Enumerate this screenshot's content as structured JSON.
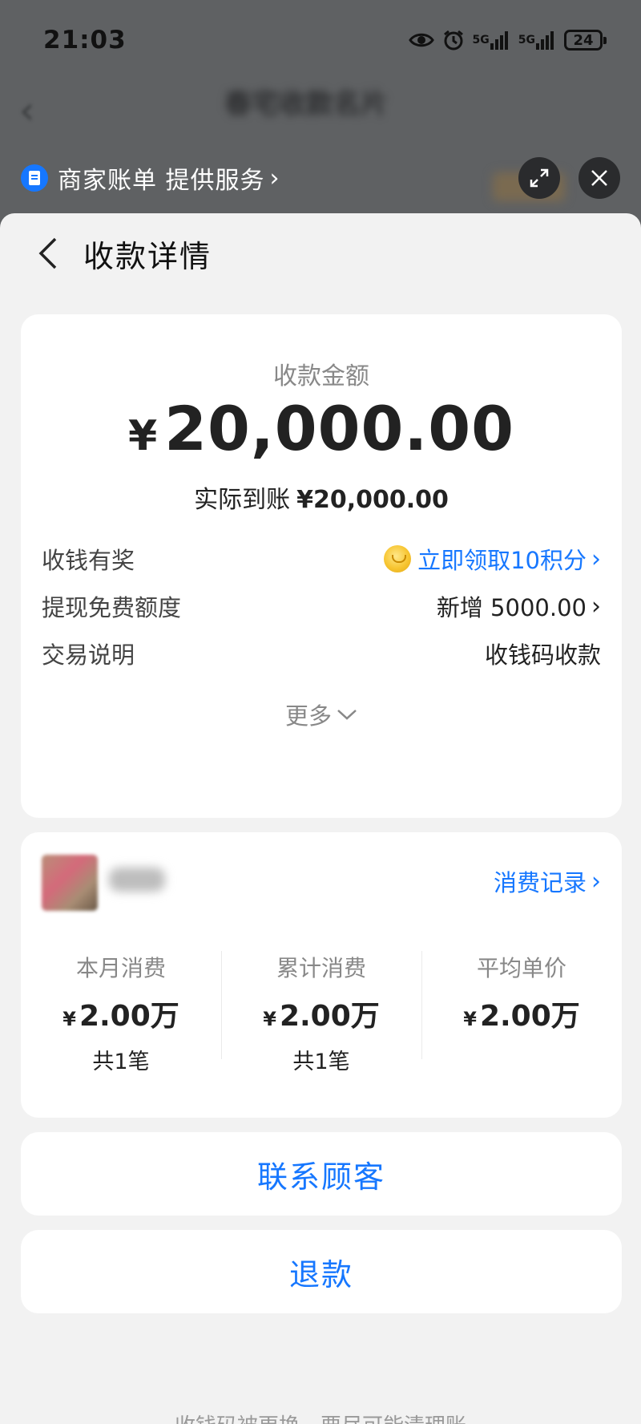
{
  "status_bar": {
    "time": "21:03",
    "signal_labels": [
      "5G",
      "5G"
    ],
    "battery": "24"
  },
  "background_page": {
    "back_glyph": "‹",
    "title": "春宅收款名片"
  },
  "mini_program": {
    "name": "商家账单 提供服务",
    "arrow": "›"
  },
  "header": {
    "title": "收款详情"
  },
  "amount_card": {
    "label": "收款金额",
    "currency": "¥",
    "amount": "20,000.00",
    "actual_label": "实际到账",
    "actual_value": "¥20,000.00",
    "rows": [
      {
        "label": "收钱有奖",
        "value": "立即领取10积分",
        "link": true
      },
      {
        "label": "提现免费额度",
        "value": "新增 5000.00",
        "link": false
      },
      {
        "label": "交易说明",
        "value": "收钱码收款",
        "link": false
      }
    ],
    "more_label": "更多"
  },
  "customer_card": {
    "records_link": "消费记录",
    "stats": [
      {
        "label": "本月消费",
        "currency": "¥",
        "value": "2.00万",
        "count": "共1笔"
      },
      {
        "label": "累计消费",
        "currency": "¥",
        "value": "2.00万",
        "count": "共1笔"
      },
      {
        "label": "平均单价",
        "currency": "¥",
        "value": "2.00万",
        "count": ""
      }
    ]
  },
  "actions": {
    "contact": "联系顾客",
    "refund": "退款"
  },
  "footer": {
    "hint": "收钱码被更换，要尽可能清理账"
  },
  "colors": {
    "accent": "#1677ff",
    "overlay": "#5f6163",
    "sheet_bg": "#f2f2f2"
  }
}
